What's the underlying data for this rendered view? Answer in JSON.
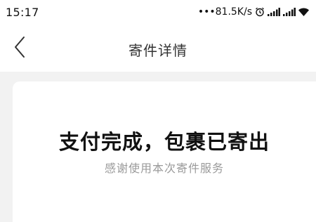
{
  "status_bar": {
    "time": "15:17",
    "network_speed": "•••81.5K/s"
  },
  "nav": {
    "title": "寄件详情"
  },
  "main": {
    "headline": "支付完成，包裹已寄出",
    "subline": "感谢使用本次寄件服务"
  }
}
